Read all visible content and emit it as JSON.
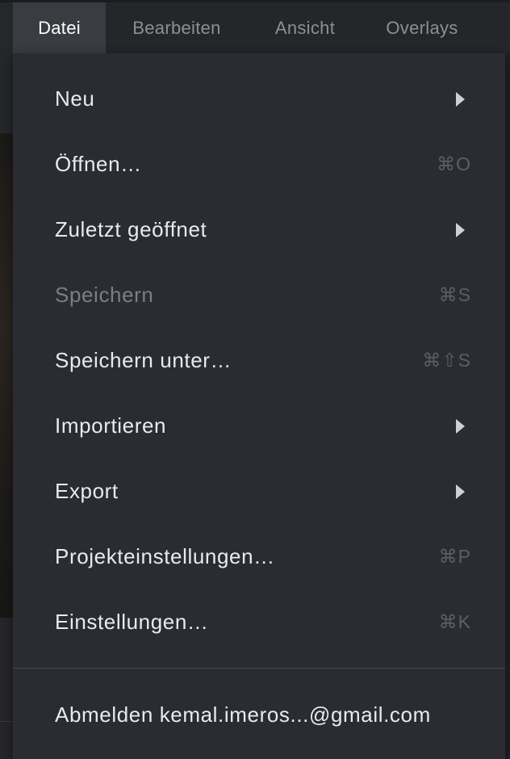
{
  "menubar": {
    "items": [
      {
        "label": "Datei",
        "active": true
      },
      {
        "label": "Bearbeiten",
        "active": false
      },
      {
        "label": "Ansicht",
        "active": false
      },
      {
        "label": "Overlays",
        "active": false
      }
    ]
  },
  "file_menu": {
    "items": [
      {
        "label": "Neu",
        "submenu": true,
        "icon": "submenu-arrow-icon"
      },
      {
        "label": "Öffnen…",
        "shortcut": "⌘O"
      },
      {
        "label": "Zuletzt geöffnet",
        "submenu": true,
        "icon": "submenu-arrow-icon"
      },
      {
        "label": "Speichern",
        "shortcut": "⌘S",
        "disabled": true
      },
      {
        "label": "Speichern unter…",
        "shortcut": "⌘⇧S"
      },
      {
        "label": "Importieren",
        "submenu": true,
        "icon": "submenu-arrow-icon"
      },
      {
        "label": "Export",
        "submenu": true,
        "icon": "submenu-arrow-icon"
      },
      {
        "label": "Projekteinstellungen…",
        "shortcut": "⌘P"
      },
      {
        "label": "Einstellungen…",
        "shortcut": "⌘K"
      }
    ],
    "logout": {
      "label": "Abmelden kemal.imeros...@gmail.com"
    }
  },
  "colors": {
    "menu_background": "#2b2c31",
    "menubar_background": "#25262a",
    "active_tab_background": "#3a3c42",
    "text": "#e9eaed",
    "text_disabled": "#7c7e84",
    "shortcut_text": "#5d5f65",
    "inactive_tab_text": "#8d8f95"
  }
}
